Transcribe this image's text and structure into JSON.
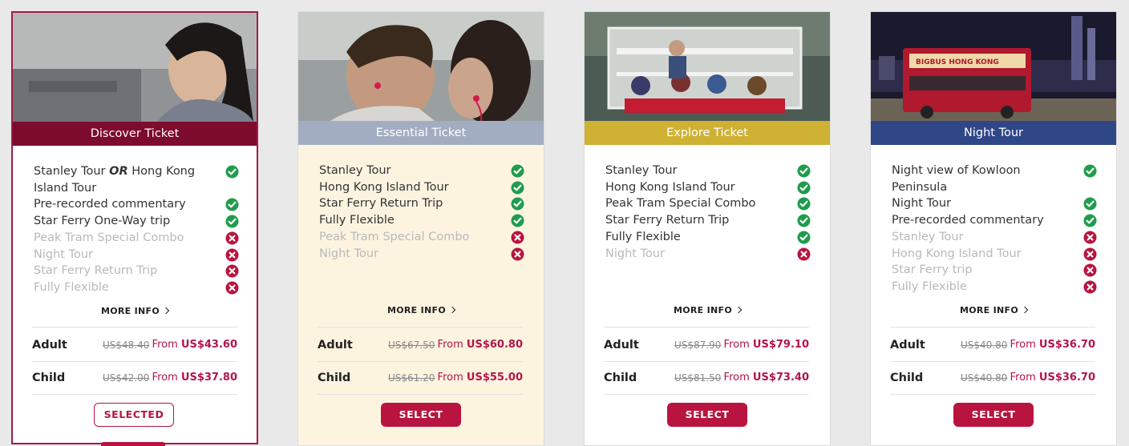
{
  "colors": {
    "accent": "#b8143f",
    "check": "#1f9d4c",
    "cross": "#b8143f"
  },
  "cards": [
    {
      "id": "discover",
      "title": "Discover Ticket",
      "header_color": "#7d0b2c",
      "features": [
        {
          "text_parts": [
            "Stanley Tour ",
            "OR",
            " Hong Kong Island Tour"
          ],
          "included": true
        },
        {
          "text": "Pre-recorded commentary",
          "included": true
        },
        {
          "text": "Star Ferry One-Way trip",
          "included": true
        },
        {
          "text": "Peak Tram Special Combo",
          "included": false
        },
        {
          "text": "Night Tour",
          "included": false
        },
        {
          "text": "Star Ferry Return Trip",
          "included": false
        },
        {
          "text": "Fully Flexible",
          "included": false
        }
      ],
      "more_info": "MORE INFO",
      "adult": {
        "label": "Adult",
        "old": "US$48.40",
        "from": "From",
        "price": "US$43.60"
      },
      "child": {
        "label": "Child",
        "old": "US$42.00",
        "from": "From",
        "price": "US$37.80"
      },
      "button": "SELECTED"
    },
    {
      "id": "essential",
      "title": "Essential Ticket",
      "header_color": "#a3adc2",
      "features": [
        {
          "text": "Stanley Tour",
          "included": true
        },
        {
          "text": "Hong Kong Island Tour",
          "included": true
        },
        {
          "text": "Star Ferry Return Trip",
          "included": true
        },
        {
          "text": "Fully Flexible",
          "included": true
        },
        {
          "text": "Peak Tram Special Combo",
          "included": false
        },
        {
          "text": "Night Tour",
          "included": false
        }
      ],
      "more_info": "MORE INFO",
      "adult": {
        "label": "Adult",
        "old": "US$67.50",
        "from": "From",
        "price": "US$60.80"
      },
      "child": {
        "label": "Child",
        "old": "US$61.20",
        "from": "From",
        "price": "US$55.00"
      },
      "button": "SELECT"
    },
    {
      "id": "explore",
      "title": "Explore Ticket",
      "header_color": "#cfb133",
      "features": [
        {
          "text": "Stanley Tour",
          "included": true
        },
        {
          "text": "Hong Kong Island Tour",
          "included": true
        },
        {
          "text": "Peak Tram Special Combo",
          "included": true
        },
        {
          "text": "Star Ferry Return Trip",
          "included": true
        },
        {
          "text": "Fully Flexible",
          "included": true
        },
        {
          "text": "Night Tour",
          "included": false
        }
      ],
      "more_info": "MORE INFO",
      "adult": {
        "label": "Adult",
        "old": "US$87.90",
        "from": "From",
        "price": "US$79.10"
      },
      "child": {
        "label": "Child",
        "old": "US$81.50",
        "from": "From",
        "price": "US$73.40"
      },
      "button": "SELECT"
    },
    {
      "id": "night",
      "title": "Night Tour",
      "header_color": "#2f4687",
      "features": [
        {
          "text": "Night view of Kowloon Peninsula",
          "included": true
        },
        {
          "text": "Night Tour",
          "included": true
        },
        {
          "text": "Pre-recorded commentary",
          "included": true
        },
        {
          "text": "Stanley Tour",
          "included": false
        },
        {
          "text": "Hong Kong Island Tour",
          "included": false
        },
        {
          "text": "Star Ferry trip",
          "included": false
        },
        {
          "text": "Fully Flexible",
          "included": false
        }
      ],
      "more_info": "MORE INFO",
      "adult": {
        "label": "Adult",
        "old": "US$40.80",
        "from": "From",
        "price": "US$36.70"
      },
      "child": {
        "label": "Child",
        "old": "US$40.80",
        "from": "From",
        "price": "US$36.70"
      },
      "button": "SELECT",
      "bus_sign": "BIGBUS HONG KONG"
    }
  ]
}
